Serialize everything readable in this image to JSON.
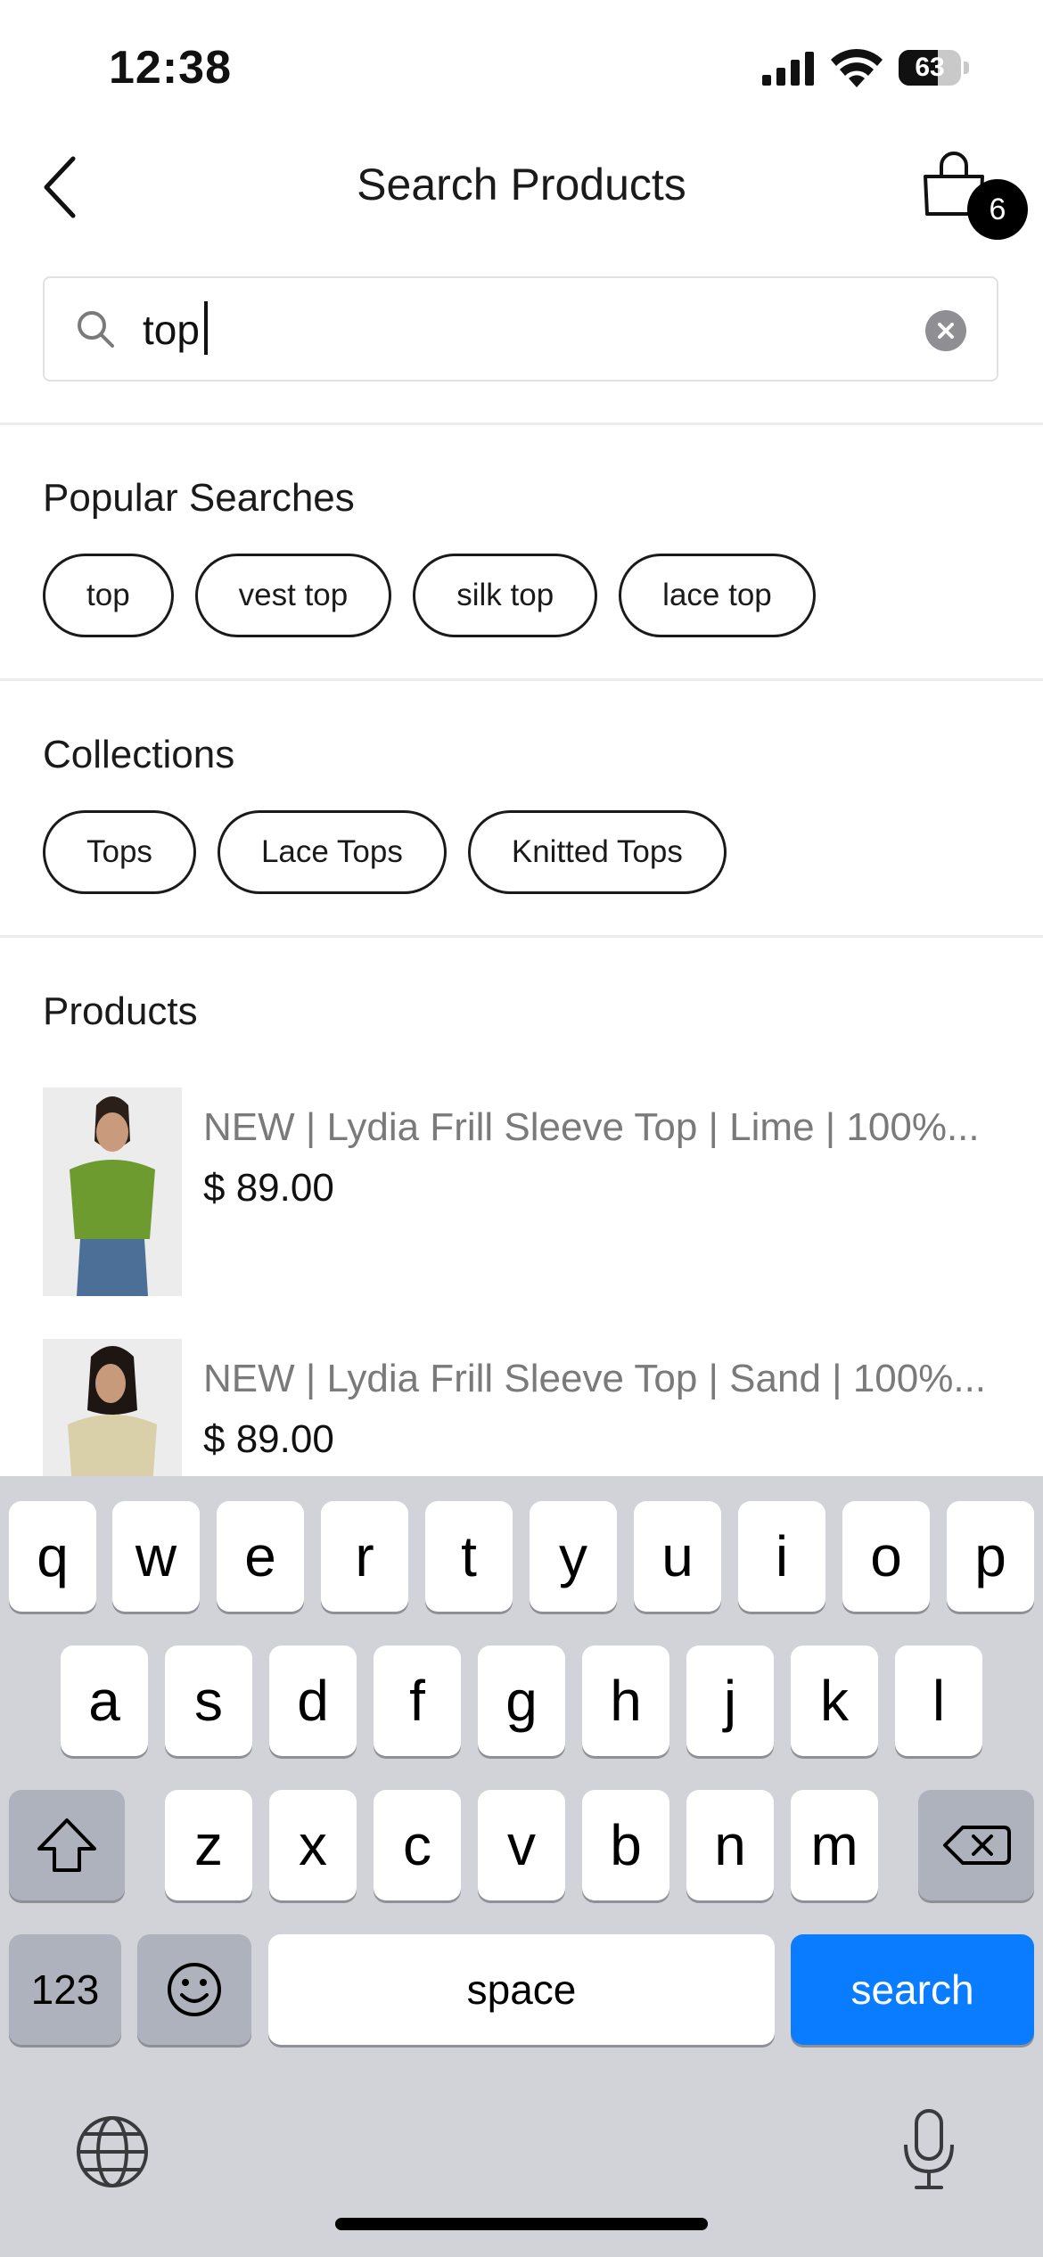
{
  "status_bar": {
    "time": "12:38",
    "battery": "63",
    "battery_level": 0.63
  },
  "header": {
    "title": "Search Products",
    "cart_count": "6"
  },
  "search": {
    "value": "top",
    "placeholder": ""
  },
  "popular": {
    "title": "Popular Searches",
    "chips": [
      "top",
      "vest top",
      "silk top",
      "lace top"
    ]
  },
  "collections": {
    "title": "Collections",
    "chips": [
      "Tops",
      "Lace Tops",
      "Knitted Tops"
    ]
  },
  "products": {
    "title": "Products",
    "items": [
      {
        "title": "NEW | Lydia Frill Sleeve Top | Lime | 100%...",
        "price": "$ 89.00",
        "color": "#6d9b2f"
      },
      {
        "title": "NEW | Lydia Frill Sleeve Top | Sand | 100%...",
        "price": "$ 89.00",
        "color": "#d9cfa9"
      }
    ]
  },
  "keyboard": {
    "row1": [
      "q",
      "w",
      "e",
      "r",
      "t",
      "y",
      "u",
      "i",
      "o",
      "p"
    ],
    "row2": [
      "a",
      "s",
      "d",
      "f",
      "g",
      "h",
      "j",
      "k",
      "l"
    ],
    "row3": [
      "z",
      "x",
      "c",
      "v",
      "b",
      "n",
      "m"
    ],
    "numbers_label": "123",
    "space_label": "space",
    "search_label": "search"
  },
  "icons": [
    "back-icon",
    "cart-icon",
    "search-icon",
    "clear-icon",
    "shift-icon",
    "delete-icon",
    "emoji-icon",
    "globe-icon",
    "microphone-icon"
  ],
  "colors": {
    "accent": "#0a7cff",
    "badge": "#000000",
    "keyboard_bg": "#d1d3d9"
  }
}
